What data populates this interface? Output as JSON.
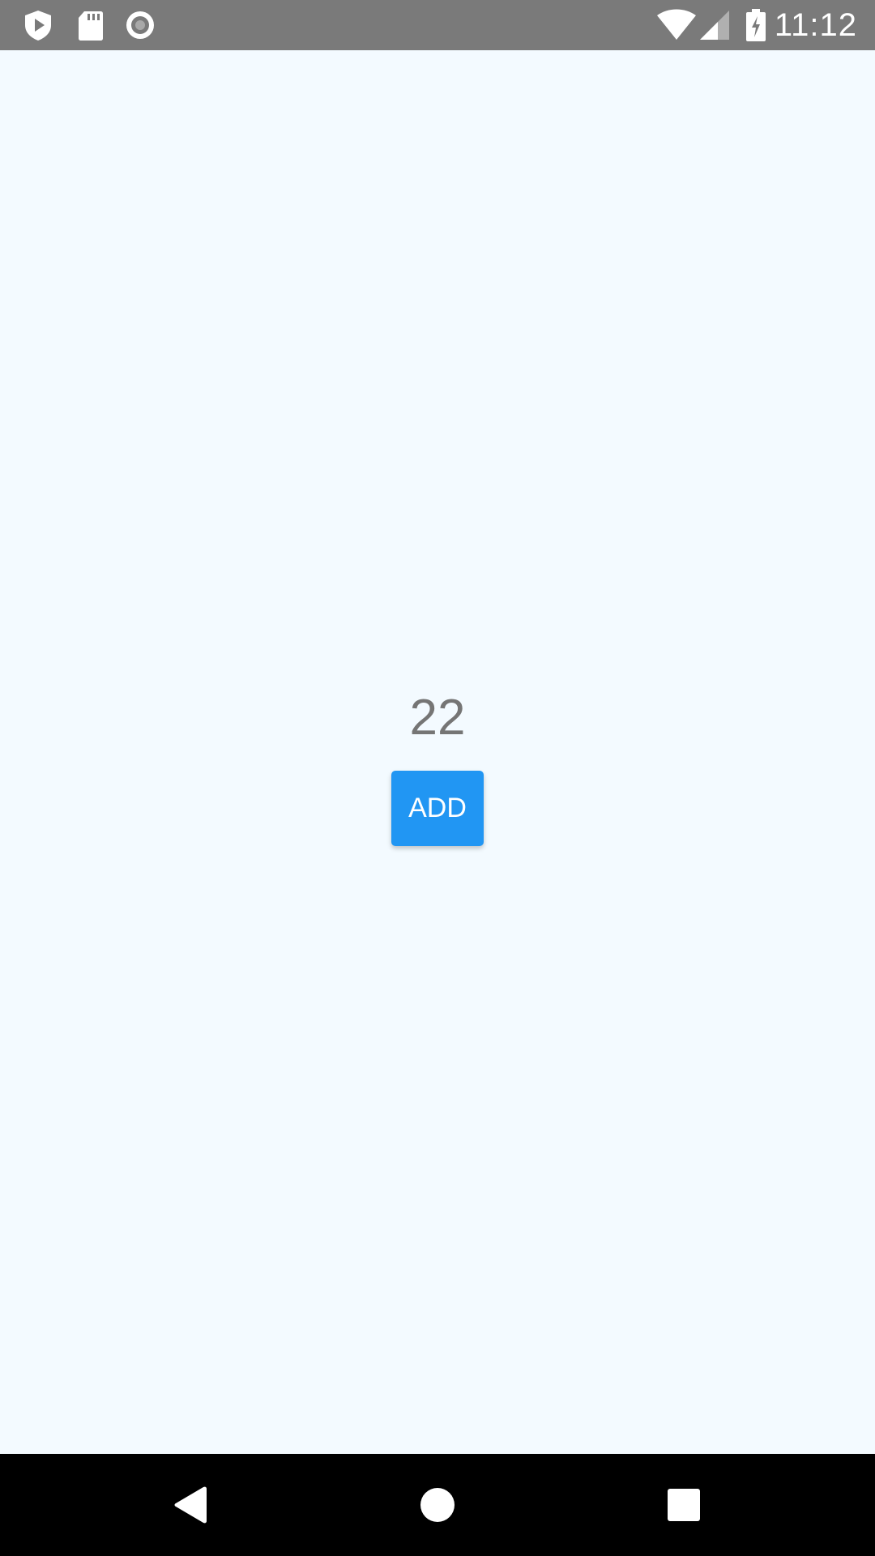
{
  "status_bar": {
    "time": "11:12",
    "left_icons": [
      "play-protect-icon",
      "sd-card-icon",
      "record-icon"
    ],
    "right_icons": [
      "wifi-icon",
      "cell-signal-icon",
      "battery-charging-icon"
    ]
  },
  "counter": {
    "value": "22"
  },
  "actions": {
    "add_label": "ADD"
  },
  "nav_bar": {
    "buttons": [
      "back-icon",
      "home-icon",
      "recents-icon"
    ]
  },
  "colors": {
    "status_bar_bg": "#7a7a7a",
    "background": "#f3faff",
    "accent": "#2196f3",
    "counter_text": "#757575",
    "nav_bar_bg": "#000000"
  }
}
